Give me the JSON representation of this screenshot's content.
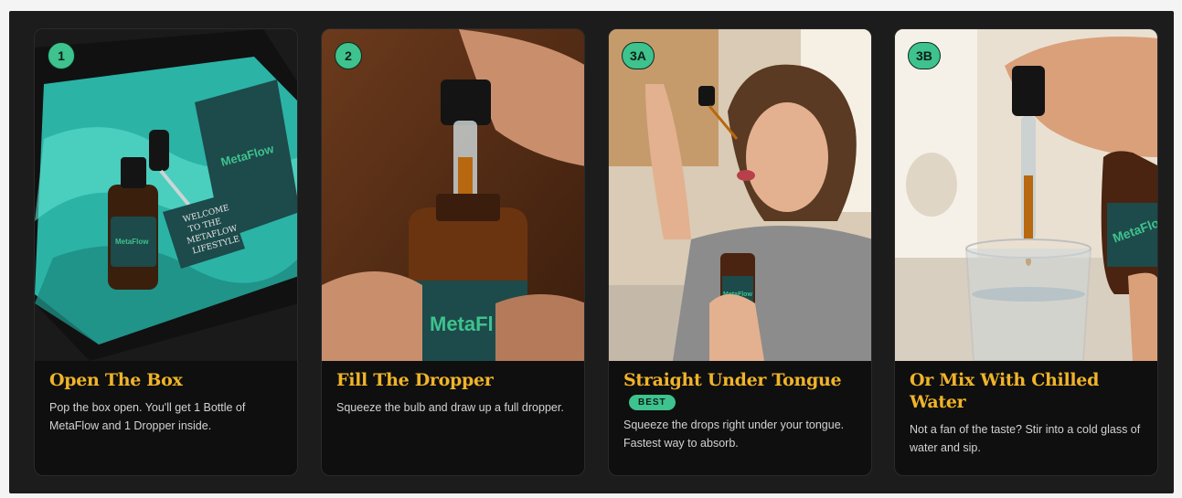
{
  "steps": [
    {
      "badge": "1",
      "title": "Open The Box",
      "description": "Pop the box open. You'll get 1 Bottle of MetaFlow and 1 Dropper inside.",
      "image": "gift-box-with-bottle-and-dropper",
      "box_text": "WELCOME TO THE METAFLOW LIFESTYLE"
    },
    {
      "badge": "2",
      "title": "Fill The Dropper",
      "description": "Squeeze the bulb and draw up a full dropper.",
      "image": "hands-filling-dropper"
    },
    {
      "badge": "3A",
      "title": "Straight Under Tongue",
      "tag": "BEST",
      "description": "Squeeze the drops right under your tongue. Fastest way to absorb.",
      "image": "woman-taking-drops-under-tongue"
    },
    {
      "badge": "3B",
      "title": "Or Mix With Chilled Water",
      "description": "Not a fan of the taste? Stir into a cold glass of water and sip.",
      "image": "dropper-into-glass-of-water"
    }
  ],
  "brand": {
    "name": "MetaFlow",
    "label_color": "#1d4a4a",
    "logo_color": "#3ec28e"
  },
  "colors": {
    "accent": "#3ec28e",
    "title": "#f0b429",
    "panel": "#1c1c1c",
    "card": "#0f0f0f"
  }
}
